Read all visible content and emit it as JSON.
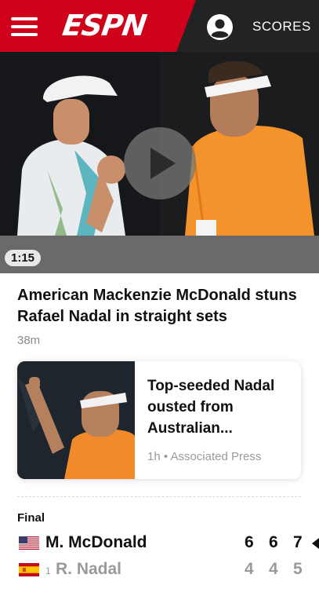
{
  "header": {
    "logo_text": "ESPN",
    "scores_label": "SCORES",
    "brand_color": "#d0021b",
    "bar_color": "#222325",
    "menu_icon": "hamburger-menu-icon",
    "profile_icon": "user-profile-icon"
  },
  "video": {
    "duration": "1:15",
    "play_icon": "play-icon"
  },
  "lead_story": {
    "headline": "American Mackenzie McDonald stuns Rafael Nadal in straight sets",
    "time": "38m"
  },
  "story_card": {
    "title": "Top-seeded Nadal ousted from Australian...",
    "meta": "1h • Associated Press"
  },
  "scoreboard": {
    "status": "Final",
    "players": [
      {
        "name": "M. McDonald",
        "seed": "",
        "flag": "usa-flag-icon",
        "sets": [
          "6",
          "6",
          "7"
        ],
        "winner": true
      },
      {
        "name": "R. Nadal",
        "seed": "1",
        "flag": "spain-flag-icon",
        "sets": [
          "4",
          "4",
          "5"
        ],
        "winner": false
      }
    ]
  }
}
